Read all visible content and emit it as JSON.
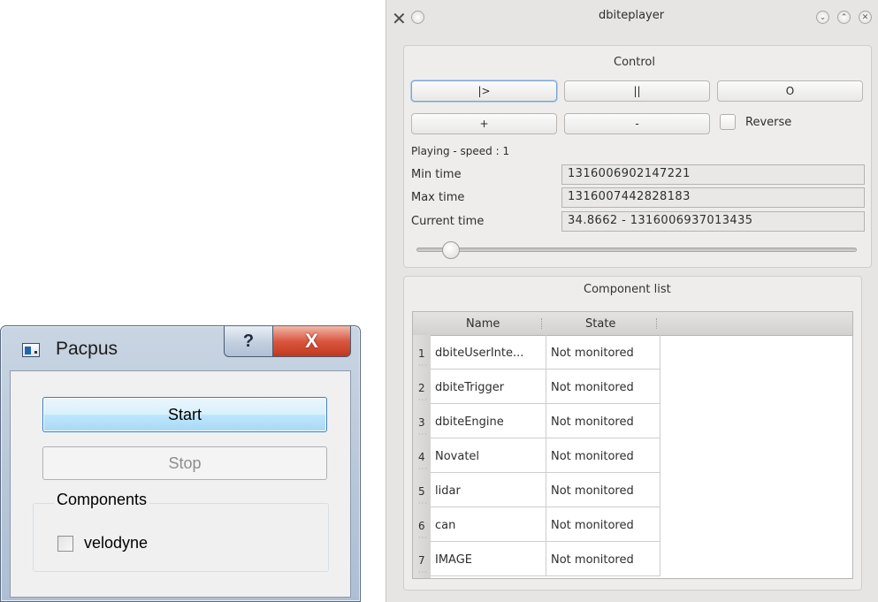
{
  "pacpus": {
    "title": "Pacpus",
    "help_glyph": "?",
    "close_glyph": "X",
    "start_label": "Start",
    "stop_label": "Stop",
    "components_group": "Components",
    "components": [
      {
        "label": "velodyne",
        "checked": false
      }
    ]
  },
  "dbiteplayer": {
    "title": "dbiteplayer",
    "control_title": "Control",
    "buttons": {
      "play": "|>",
      "pause": "||",
      "stop": "O",
      "faster": "+",
      "slower": "-"
    },
    "reverse_label": "Reverse",
    "reverse_checked": false,
    "status": "Playing - speed : 1",
    "min_time_label": "Min time",
    "min_time_value": "1316006902147221",
    "max_time_label": "Max time",
    "max_time_value": "1316007442828183",
    "current_time_label": "Current time",
    "current_time_value": "34.8662 - 1316006937013435",
    "slider_position_fraction": 0.06,
    "component_list_title": "Component list",
    "table": {
      "columns": [
        "Name",
        "State"
      ],
      "rows": [
        {
          "num": "1",
          "name": "dbiteUserInte...",
          "state": "Not monitored"
        },
        {
          "num": "2",
          "name": "dbiteTrigger",
          "state": "Not monitored"
        },
        {
          "num": "3",
          "name": "dbiteEngine",
          "state": "Not monitored"
        },
        {
          "num": "4",
          "name": "Novatel",
          "state": "Not monitored"
        },
        {
          "num": "5",
          "name": "lidar",
          "state": "Not monitored"
        },
        {
          "num": "6",
          "name": "can",
          "state": "Not monitored"
        },
        {
          "num": "7",
          "name": "IMAGE",
          "state": "Not monitored"
        }
      ]
    }
  }
}
